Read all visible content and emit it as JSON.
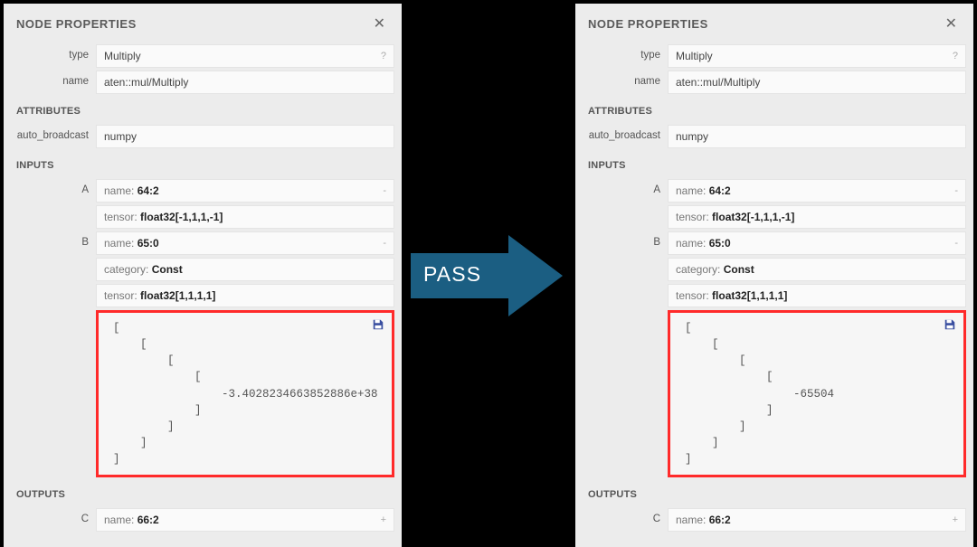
{
  "arrow_label": "PASS",
  "left": {
    "panel_title": "NODE PROPERTIES",
    "type_label": "type",
    "type_value": "Multiply",
    "type_hint": "?",
    "name_label": "name",
    "name_value": "aten::mul/Multiply",
    "attributes_header": "ATTRIBUTES",
    "auto_broadcast_label": "auto_broadcast",
    "auto_broadcast_value": "numpy",
    "inputs_header": "INPUTS",
    "inputA_label": "A",
    "inputA_name_k": "name: ",
    "inputA_name_v": "64:2",
    "inputA_tensor_k": "tensor: ",
    "inputA_tensor_v": "float32[-1,1,1,-1]",
    "inputB_label": "B",
    "inputB_name_k": "name: ",
    "inputB_name_v": "65:0",
    "inputB_cat_k": "category: ",
    "inputB_cat_v": "Const",
    "inputB_tensor_k": "tensor: ",
    "inputB_tensor_v": "float32[1,1,1,1]",
    "tensor_text": "[\n    [\n        [\n            [\n                -3.4028234663852886e+38\n            ]\n        ]\n    ]\n]",
    "outputs_header": "OUTPUTS",
    "outputC_label": "C",
    "outputC_name_k": "name: ",
    "outputC_name_v": "66:2"
  },
  "right": {
    "panel_title": "NODE PROPERTIES",
    "type_label": "type",
    "type_value": "Multiply",
    "type_hint": "?",
    "name_label": "name",
    "name_value": "aten::mul/Multiply",
    "attributes_header": "ATTRIBUTES",
    "auto_broadcast_label": "auto_broadcast",
    "auto_broadcast_value": "numpy",
    "inputs_header": "INPUTS",
    "inputA_label": "A",
    "inputA_name_k": "name: ",
    "inputA_name_v": "64:2",
    "inputA_tensor_k": "tensor: ",
    "inputA_tensor_v": "float32[-1,1,1,-1]",
    "inputB_label": "B",
    "inputB_name_k": "name: ",
    "inputB_name_v": "65:0",
    "inputB_cat_k": "category: ",
    "inputB_cat_v": "Const",
    "inputB_tensor_k": "tensor: ",
    "inputB_tensor_v": "float32[1,1,1,1]",
    "tensor_text": "[\n    [\n        [\n            [\n                -65504\n            ]\n        ]\n    ]\n]",
    "outputs_header": "OUTPUTS",
    "outputC_label": "C",
    "outputC_name_k": "name: ",
    "outputC_name_v": "66:2"
  }
}
